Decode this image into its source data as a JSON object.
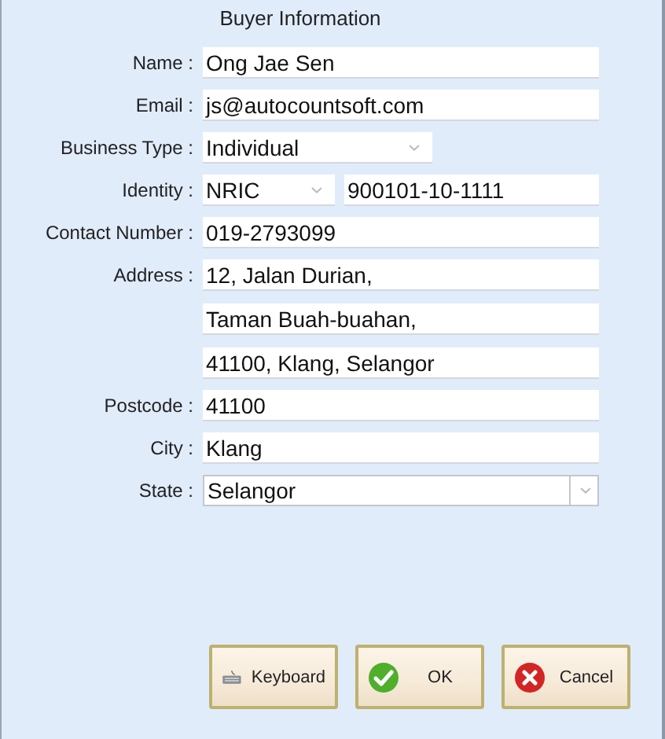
{
  "title": "Buyer Information",
  "fields": [
    {
      "kind": "text",
      "label": "Name :",
      "value": "Ong Jae Sen"
    },
    {
      "kind": "text",
      "label": "Email :",
      "value": "js@autocountsoft.com"
    },
    {
      "kind": "short-select",
      "label": "Business Type :",
      "value": "Individual"
    },
    {
      "kind": "select-text",
      "label": "Identity :",
      "option": "NRIC",
      "value": "900101-10-1111"
    },
    {
      "kind": "text",
      "label": "Contact Number :",
      "value": "019-2793099"
    },
    {
      "kind": "lines",
      "label": "Address :",
      "lines": [
        "12, Jalan Durian,",
        "Taman Buah-buahan,",
        "41100, Klang, Selangor"
      ]
    },
    {
      "kind": "text",
      "label": "Postcode :",
      "value": "41100"
    },
    {
      "kind": "text",
      "label": "City :",
      "value": "Klang"
    },
    {
      "kind": "select",
      "label": "State :",
      "value": "Selangor"
    }
  ],
  "buttons": [
    {
      "kind": "keyboard",
      "label": "Keyboard"
    },
    {
      "kind": "ok",
      "label": "OK"
    },
    {
      "kind": "cancel",
      "label": "Cancel"
    }
  ]
}
